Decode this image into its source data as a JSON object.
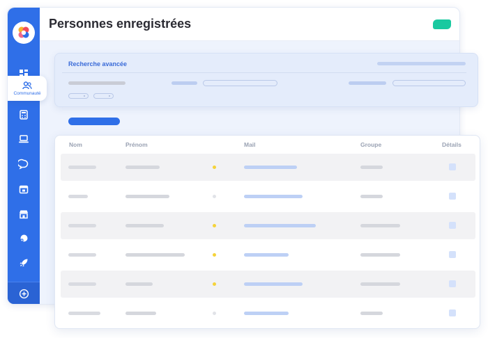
{
  "page": {
    "title": "Personnes enregistrées"
  },
  "sidebar": {
    "active_label": "Communauté",
    "icons": [
      "dashboard-icon",
      "community-icon",
      "calculator-icon",
      "laptop-icon",
      "chat-icon",
      "calendar-icon",
      "store-icon",
      "support-icon",
      "rocket-icon",
      "add-circle-icon"
    ]
  },
  "search": {
    "title": "Recherche avancée"
  },
  "table": {
    "headers": [
      "Nom",
      "Prénom",
      "Mail",
      "Groupe",
      "Détails"
    ],
    "rows": [
      {
        "status": "yellow"
      },
      {
        "status": "grey"
      },
      {
        "status": "yellow"
      },
      {
        "status": "yellow"
      },
      {
        "status": "yellow"
      },
      {
        "status": "grey"
      }
    ]
  },
  "colors": {
    "sidebar": "#2f6fe8",
    "accent_badge": "#19c9a0",
    "status_yellow": "#f5d33a",
    "status_grey": "#e1e3e8"
  }
}
